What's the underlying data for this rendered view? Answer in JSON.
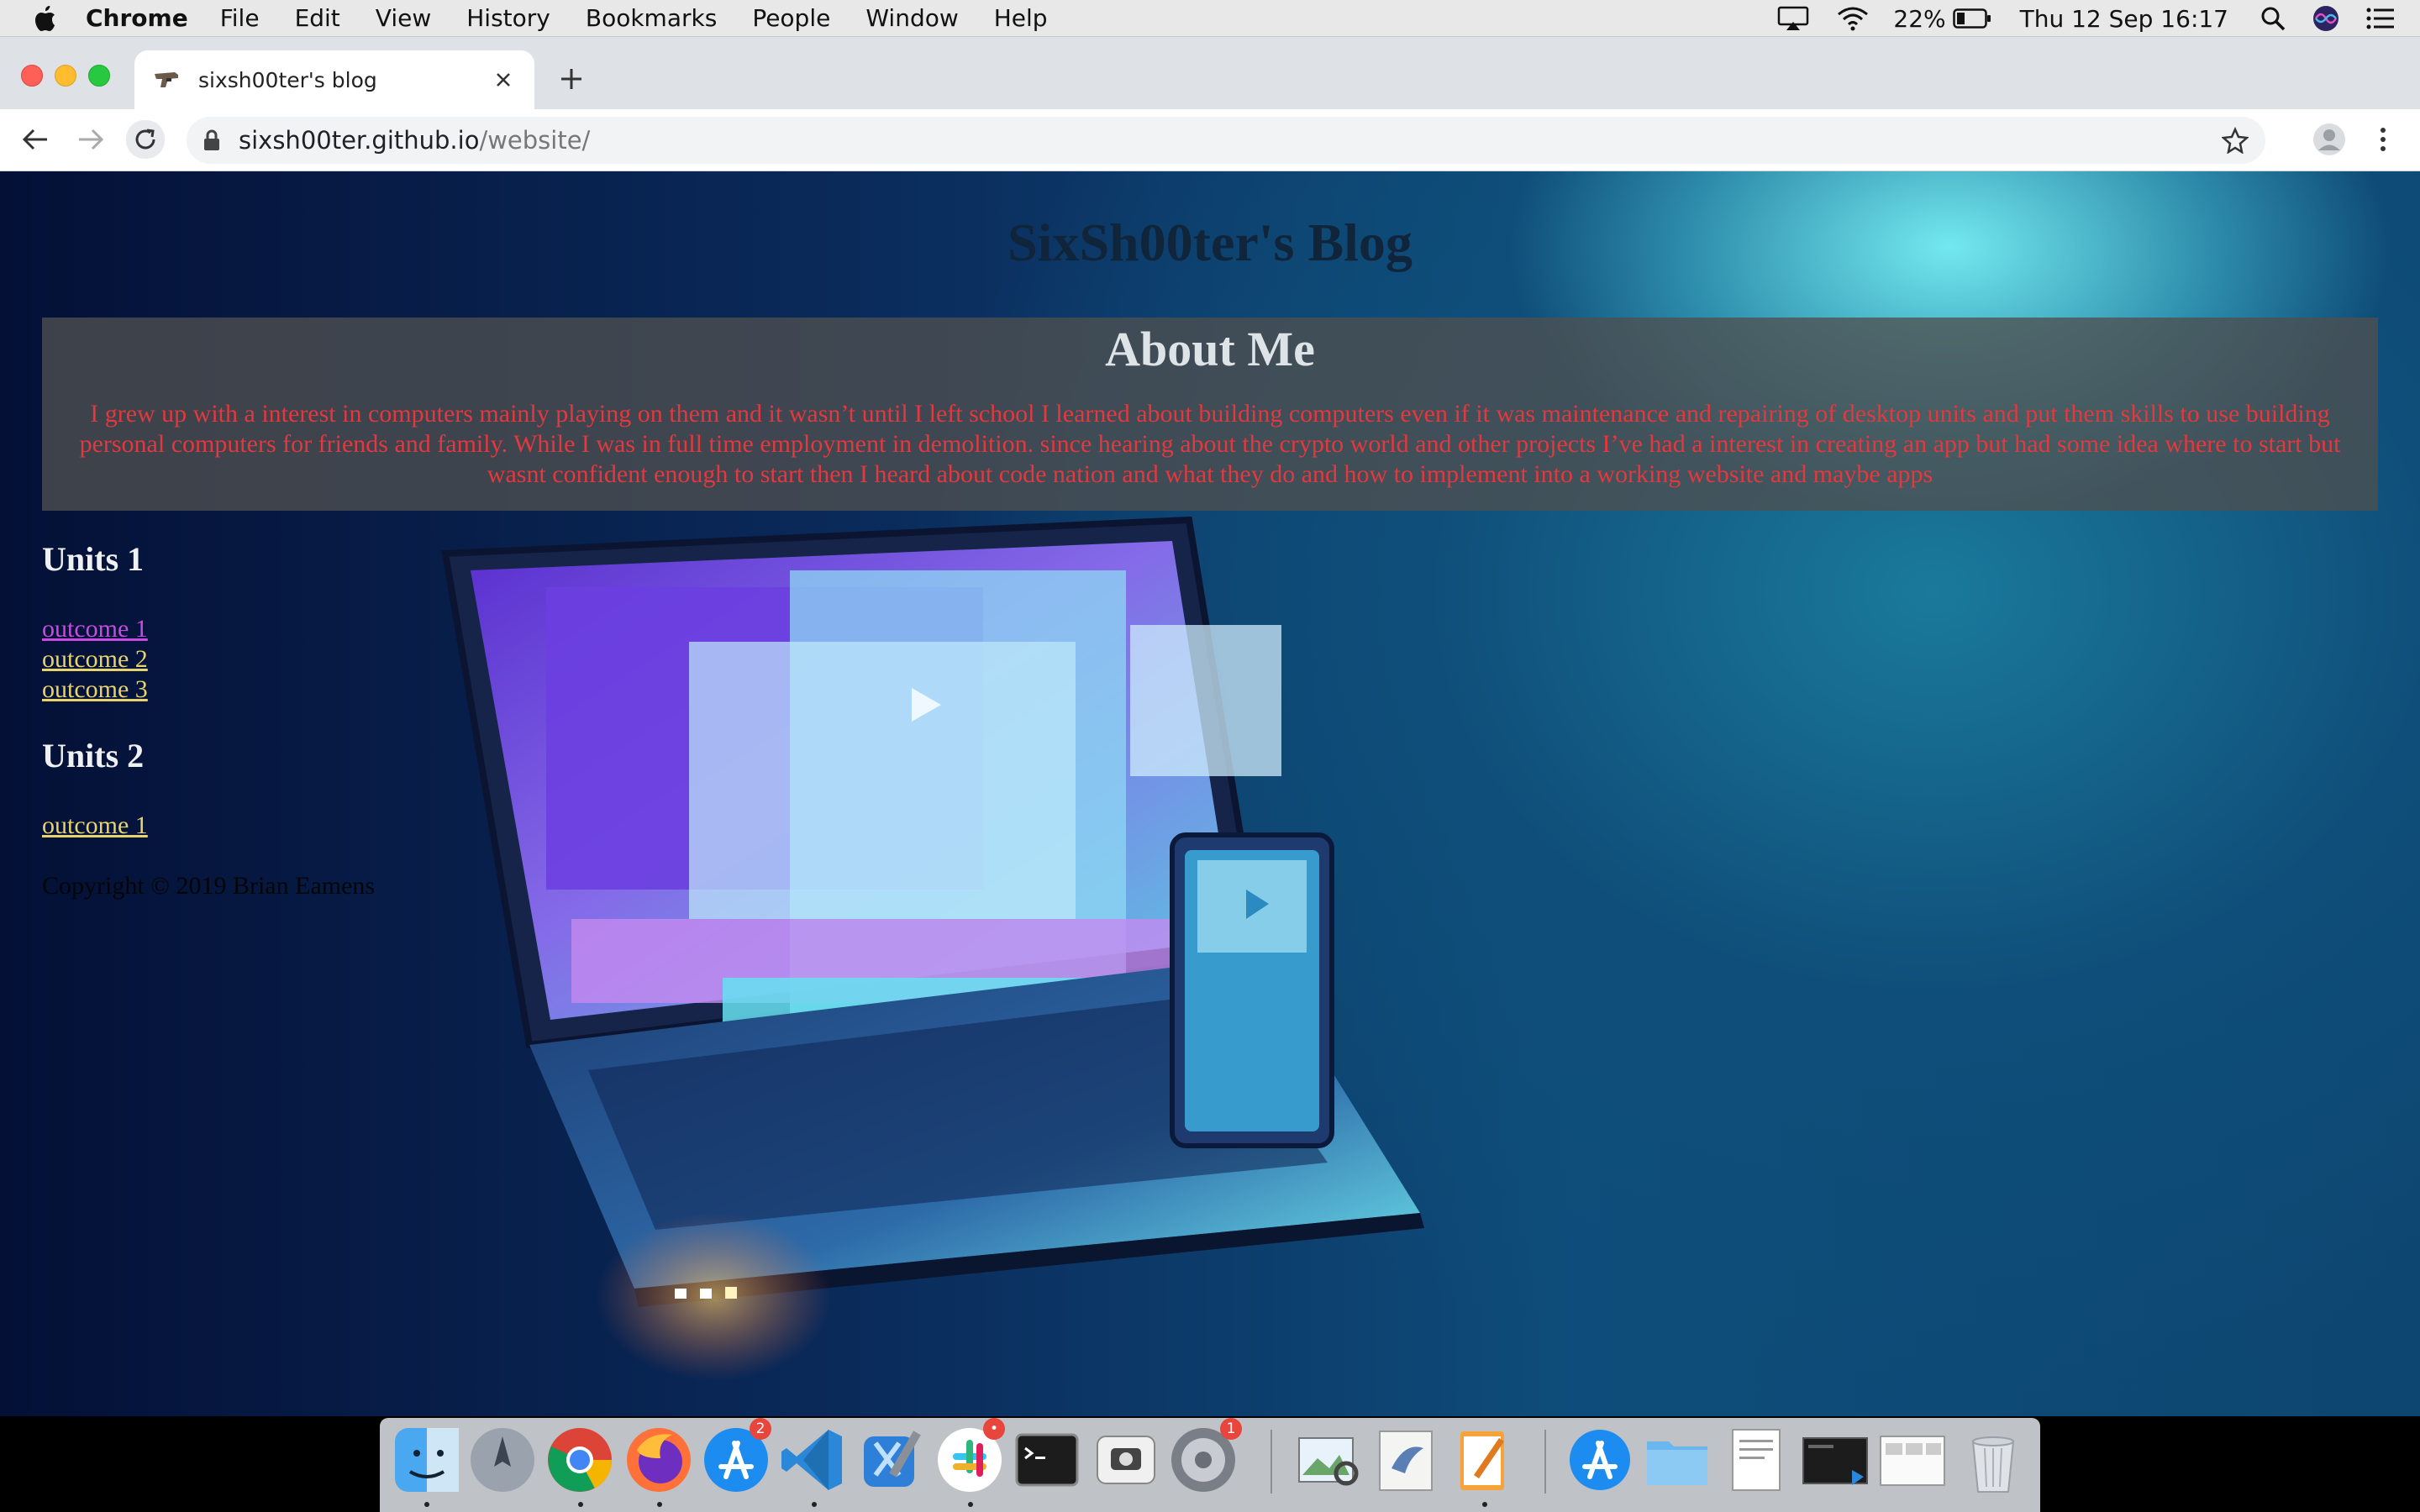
{
  "menubar": {
    "app_name": "Chrome",
    "items": [
      "File",
      "Edit",
      "View",
      "History",
      "Bookmarks",
      "People",
      "Window",
      "Help"
    ],
    "battery": "22%",
    "clock": "Thu 12 Sep  16:17"
  },
  "browser": {
    "tab_title": "sixsh00ter's blog",
    "url_host": "sixsh00ter.github.io",
    "url_path": "/website/"
  },
  "page": {
    "title": "SixSh00ter's Blog",
    "about_heading": "About Me",
    "about_text": "I grew up with a interest in computers mainly playing on them and it wasn’t until I left school I learned about building computers even if it was maintenance and repairing of desktop units and put them skills to use building personal computers for friends and family. While I was in full time employment in demolition. since hearing about the crypto world and other projects I’ve had a interest in creating an app but had some idea where to start but wasnt confident enough to start then I heard about code nation and what they do and how to implement into a working website and maybe apps",
    "units": [
      {
        "heading": "Units 1",
        "links": [
          "outcome 1",
          "outcome 2",
          "outcome 3"
        ]
      },
      {
        "heading": "Units 2",
        "links": [
          "outcome 1"
        ]
      }
    ],
    "copyright": "Copyright © 2019 Brian Eamens"
  },
  "dock": {
    "apps": [
      "finder-icon",
      "launchpad-icon",
      "chrome-icon",
      "firefox-icon",
      "app-store-icon",
      "vscode-icon",
      "xcode-icon",
      "slack-icon",
      "terminal-icon",
      "screenshot-icon",
      "system-preferences-icon",
      "preview-icon",
      "mail-icon",
      "pages-icon",
      "app-store-folder-icon",
      "documents-folder-icon",
      "document-icon",
      "screen-icon",
      "window-icon",
      "trash-icon"
    ],
    "badges": {
      "app-store": "2",
      "slack": "•",
      "system-preferences": "1"
    }
  },
  "colors": {
    "about_text": "#e3383e",
    "link": "#e7d36c",
    "link_visited": "#c74be0",
    "title": "#10243a"
  }
}
